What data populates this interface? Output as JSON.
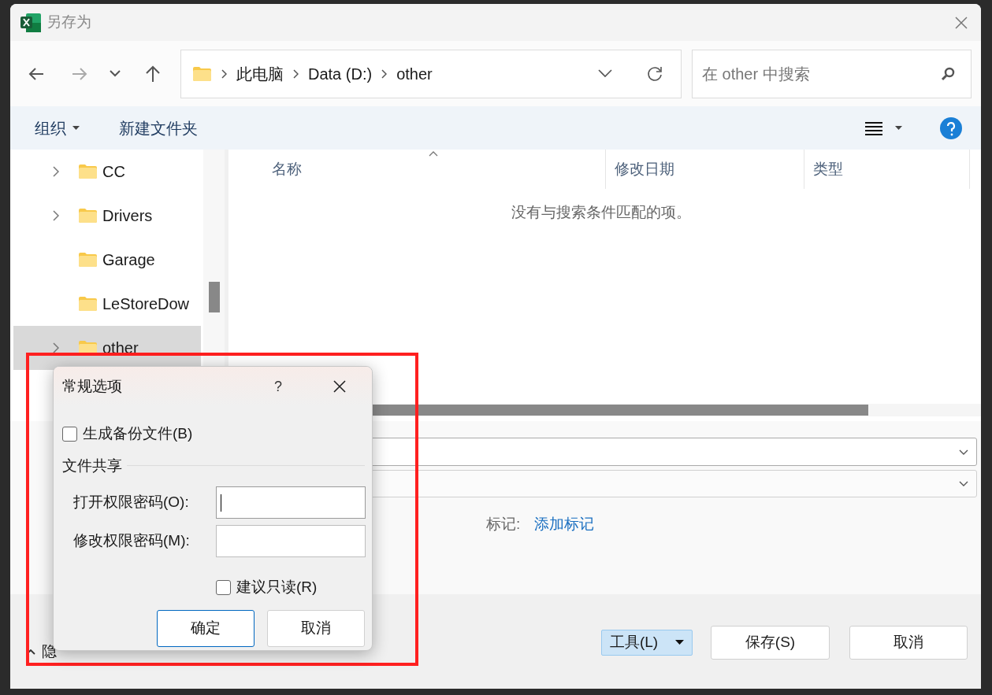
{
  "window": {
    "title": "另存为"
  },
  "nav": {
    "breadcrumb": [
      "此电脑",
      "Data (D:)",
      "other"
    ],
    "search": {
      "placeholder": "在 other 中搜索"
    }
  },
  "commands": [
    {
      "label": "组织",
      "dropdown": true
    },
    {
      "label": "新建文件夹",
      "dropdown": false
    }
  ],
  "sidebar": {
    "items": [
      {
        "label": "CC",
        "expandable": true,
        "selected": false
      },
      {
        "label": "Drivers",
        "expandable": true,
        "selected": false
      },
      {
        "label": "Garage",
        "expandable": false,
        "selected": false
      },
      {
        "label": "LeStoreDow",
        "expandable": false,
        "selected": false
      },
      {
        "label": "other",
        "expandable": true,
        "selected": true
      }
    ]
  },
  "file_list": {
    "columns": [
      "名称",
      "修改日期",
      "类型"
    ],
    "empty_message": "没有与搜索条件匹配的项。"
  },
  "form": {
    "tags_label": "标记:",
    "tags_link": "添加标记"
  },
  "footer": {
    "hide_folders": "隐",
    "tools": "工具(L)",
    "save": "保存(S)",
    "cancel": "取消"
  },
  "options_dialog": {
    "title": "常规选项",
    "help": "?",
    "backup": {
      "label": "生成备份文件(B)",
      "checked": false
    },
    "section": "文件共享",
    "fields": [
      {
        "label": "打开权限密码(O):",
        "focused": true
      },
      {
        "label": "修改权限密码(M):",
        "focused": false
      }
    ],
    "read_only": {
      "label": "建议只读(R)",
      "checked": false
    },
    "buttons": [
      {
        "label": "确定",
        "default": true
      },
      {
        "label": "取消",
        "default": false
      }
    ]
  }
}
